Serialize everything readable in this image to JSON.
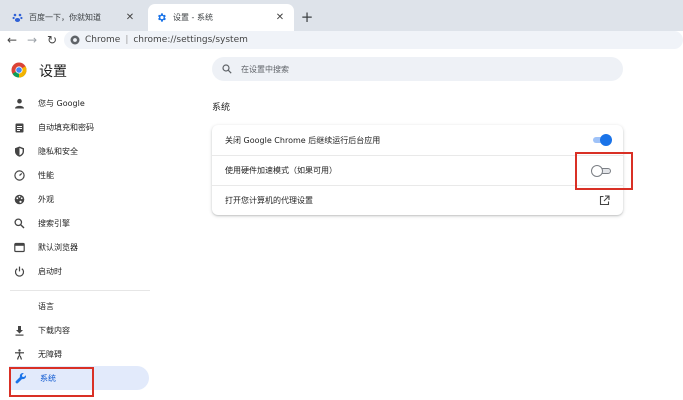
{
  "tabs": [
    {
      "title": "百度一下，你就知道",
      "active": false,
      "icon": "baidu-paw-icon"
    },
    {
      "title": "设置 - 系统",
      "active": true,
      "icon": "settings-gear-icon"
    }
  ],
  "toolbar": {
    "url_label": "Chrome",
    "url": "chrome://settings/system"
  },
  "app": {
    "title": "设置",
    "search_placeholder": "在设置中搜索"
  },
  "sidebar": {
    "items": [
      {
        "label": "您与 Google",
        "icon": "person-icon"
      },
      {
        "label": "自动填充和密码",
        "icon": "clipboard-icon"
      },
      {
        "label": "隐私和安全",
        "icon": "shield-icon"
      },
      {
        "label": "性能",
        "icon": "speedometer-icon"
      },
      {
        "label": "外观",
        "icon": "palette-icon"
      },
      {
        "label": "搜索引擎",
        "icon": "search-icon"
      },
      {
        "label": "默认浏览器",
        "icon": "browser-window-icon"
      },
      {
        "label": "启动时",
        "icon": "power-icon"
      },
      {
        "label": "语言",
        "icon": ""
      },
      {
        "label": "下载内容",
        "icon": "download-icon"
      },
      {
        "label": "无障碍",
        "icon": "accessibility-icon"
      },
      {
        "label": "系统",
        "icon": "wrench-icon",
        "active": true
      }
    ]
  },
  "main": {
    "section_title": "系统",
    "rows": [
      {
        "label": "关闭 Google Chrome 后继续运行后台应用",
        "control": "toggle",
        "state": "on"
      },
      {
        "label": "使用硬件加速模式（如果可用）",
        "control": "toggle",
        "state": "off"
      },
      {
        "label": "打开您计算机的代理设置",
        "control": "external-link"
      }
    ]
  },
  "colors": {
    "accent": "#1a73e8",
    "highlight_box": "#d93025",
    "active_nav_bg": "#e2eafb",
    "tabstrip_bg": "#dee3ea"
  }
}
